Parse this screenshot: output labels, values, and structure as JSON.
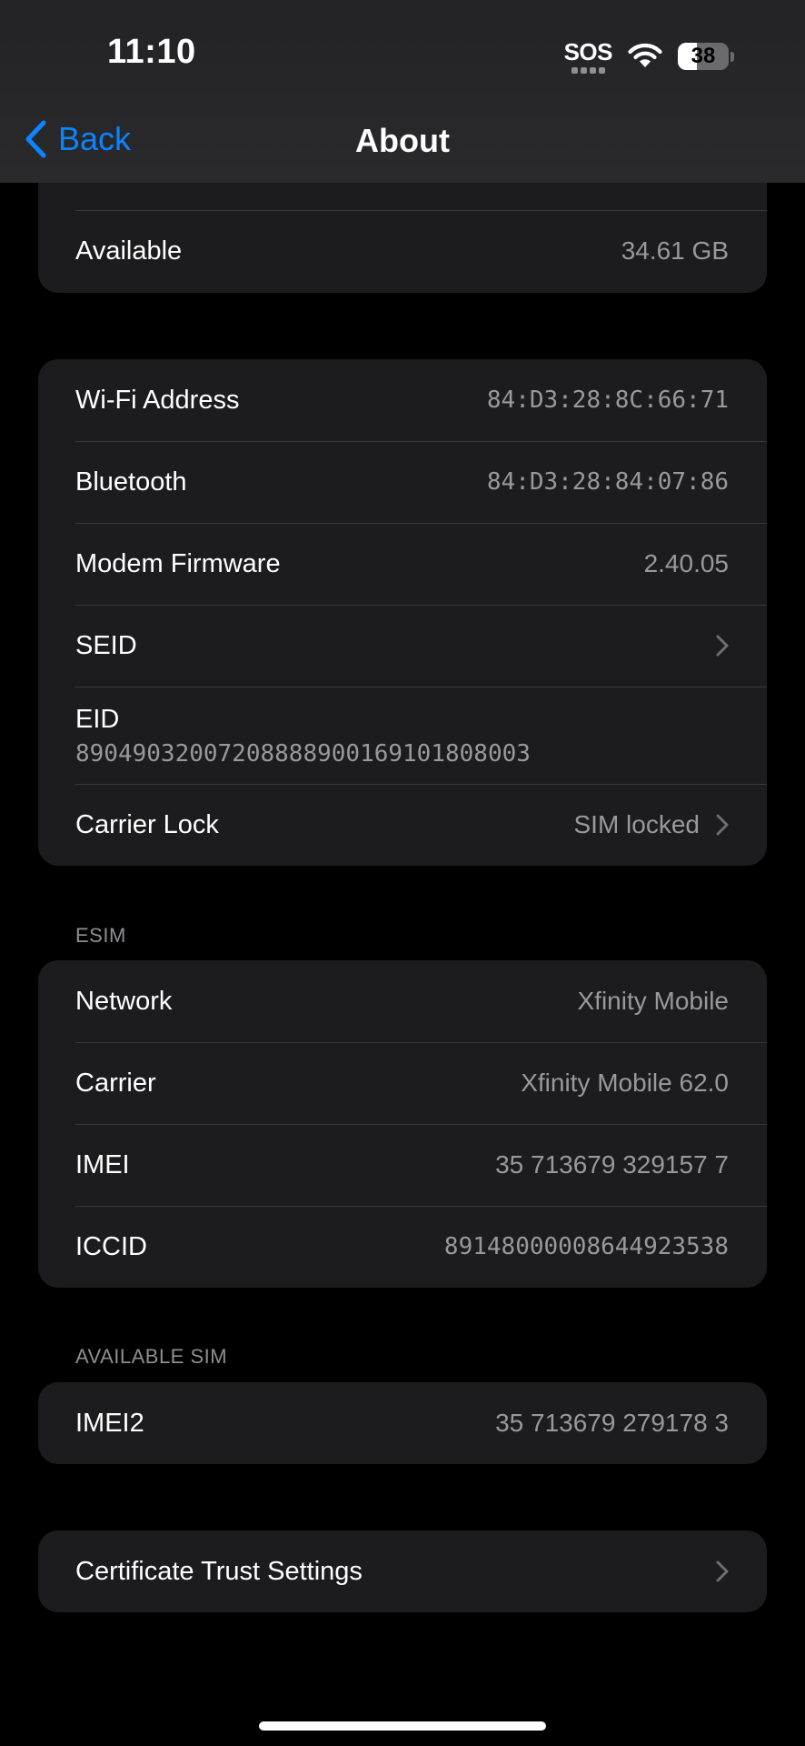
{
  "status_bar": {
    "time": "11:10",
    "sos": "SOS",
    "battery_level": "38",
    "battery_fraction": 0.38
  },
  "nav": {
    "back_label": "Back",
    "title": "About"
  },
  "storage_group": {
    "available_label": "Available",
    "available_value": "34.61 GB"
  },
  "hardware_group": {
    "wifi_label": "Wi-Fi Address",
    "wifi_value": "84:D3:28:8C:66:71",
    "bluetooth_label": "Bluetooth",
    "bluetooth_value": "84:D3:28:84:07:86",
    "modem_label": "Modem Firmware",
    "modem_value": "2.40.05",
    "seid_label": "SEID",
    "eid_label": "EID",
    "eid_value": "89049032007208888900169101808003",
    "carrier_lock_label": "Carrier Lock",
    "carrier_lock_value": "SIM locked"
  },
  "esim": {
    "header": "ESIM",
    "network_label": "Network",
    "network_value": "Xfinity Mobile",
    "carrier_label": "Carrier",
    "carrier_value": "Xfinity Mobile 62.0",
    "imei_label": "IMEI",
    "imei_value": "35 713679 329157 7",
    "iccid_label": "ICCID",
    "iccid_value": "8914800000864492353​8"
  },
  "available_sim": {
    "header": "AVAILABLE SIM",
    "imei2_label": "IMEI2",
    "imei2_value": "35 713679 279178 3"
  },
  "cert_group": {
    "label": "Certificate Trust Settings"
  },
  "colors": {
    "accent": "#0a84ff",
    "background": "#000000",
    "group_bg": "#1c1c1e",
    "secondary_text": "#98989f"
  }
}
